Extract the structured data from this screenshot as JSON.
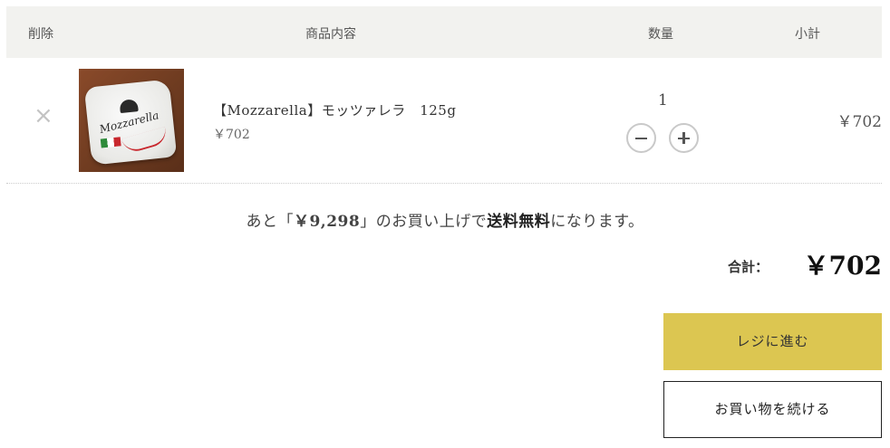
{
  "table_header": {
    "delete": "削除",
    "product": "商品内容",
    "quantity": "数量",
    "subtotal": "小計"
  },
  "cart_items": [
    {
      "remove_icon": "close-icon",
      "image": "mozzarella-package-image",
      "image_text": "Mozzarella",
      "name": "【Mozzarella】モッツァレラ　125g",
      "price": "￥702",
      "quantity": "1",
      "subtotal": "￥702"
    }
  ],
  "free_shipping": {
    "prefix": "あと「",
    "amount": "￥9,298",
    "middle": "」のお買い上げで",
    "highlight": "送料無料",
    "suffix": "になります。"
  },
  "total": {
    "label": "合計：",
    "value": "￥702"
  },
  "buttons": {
    "checkout": "レジに進む",
    "continue": "お買い物を続ける"
  },
  "colors": {
    "header_bg": "#f2f2ef",
    "checkout_bg": "#dcc651"
  },
  "icons": {
    "decrease": "minus-circle-icon",
    "increase": "plus-circle-icon"
  }
}
